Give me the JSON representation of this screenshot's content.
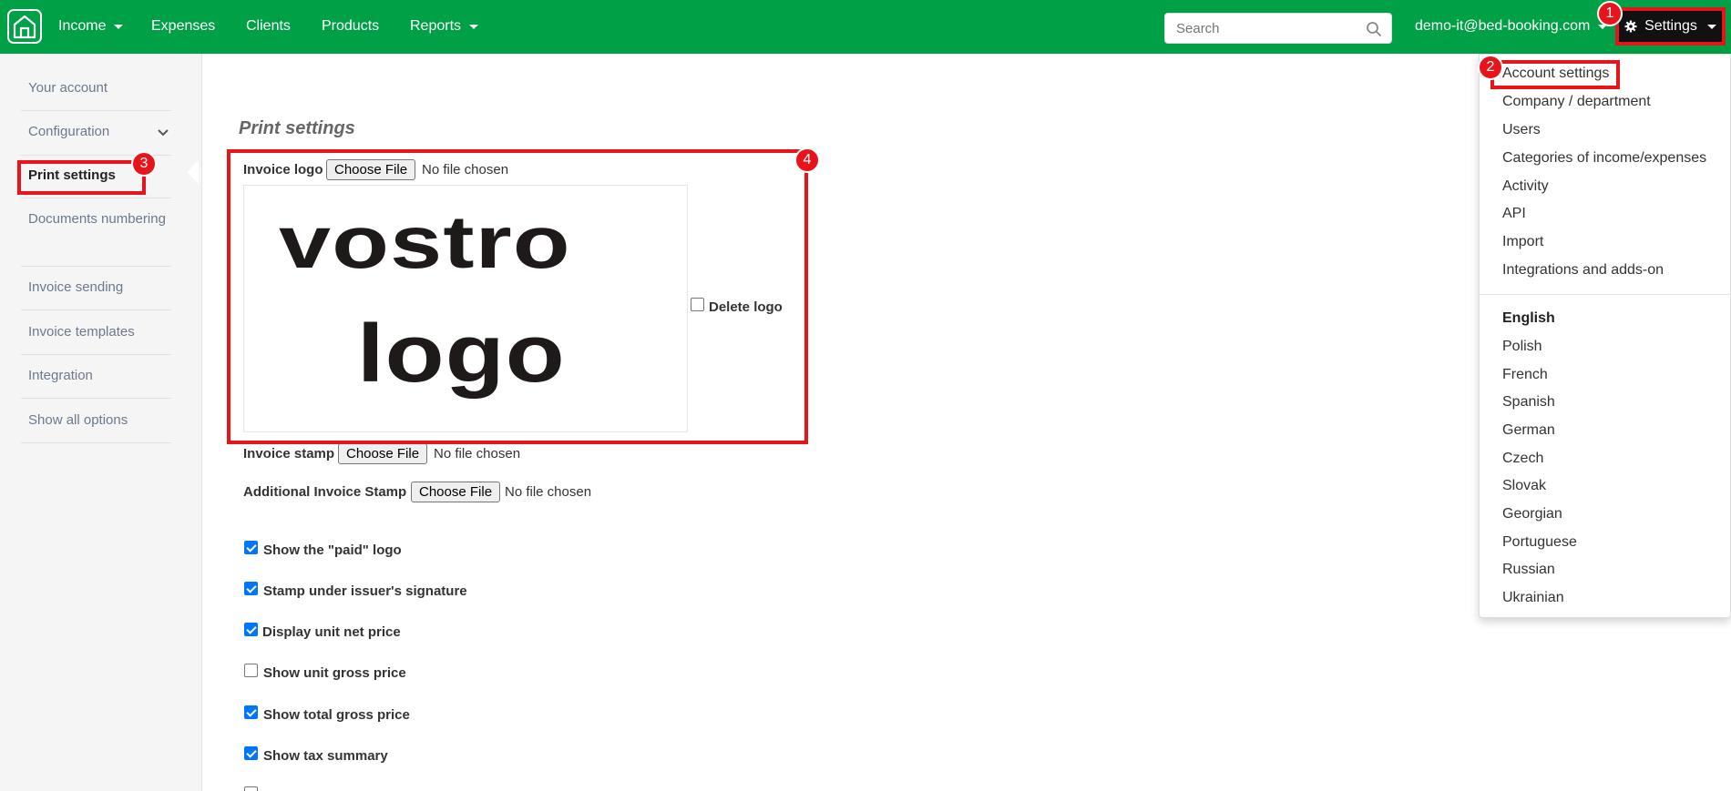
{
  "nav": {
    "items": [
      {
        "label": "Income",
        "has_caret": true
      },
      {
        "label": "Expenses",
        "has_caret": false
      },
      {
        "label": "Clients",
        "has_caret": false
      },
      {
        "label": "Products",
        "has_caret": false
      },
      {
        "label": "Reports",
        "has_caret": true
      }
    ],
    "search_placeholder": "Search",
    "user_email": "demo-it@bed-booking.com",
    "settings_label": "Settings",
    "brand_color": "#00a046"
  },
  "sidebar": {
    "items": [
      {
        "label": "Your account"
      },
      {
        "label": "Configuration"
      },
      {
        "label": "Print settings",
        "active": true
      },
      {
        "label": "Documents numbering"
      },
      {
        "label": "Invoice sending"
      },
      {
        "label": "Invoice templates"
      },
      {
        "label": "Integration"
      },
      {
        "label": "Show all options"
      }
    ]
  },
  "main": {
    "title": "Print settings",
    "invoice_logo": {
      "label": "Invoice logo",
      "button": "Choose File",
      "status": "No file chosen"
    },
    "logo_image_text": [
      "vostro",
      "logo"
    ],
    "delete_logo_label": "Delete logo",
    "invoice_stamp": {
      "label": "Invoice stamp",
      "button": "Choose File",
      "status": "No file chosen"
    },
    "additional_stamp": {
      "label": "Additional Invoice Stamp",
      "button": "Choose File",
      "status": "No file chosen"
    },
    "options": [
      {
        "label": "Show the \"paid\" logo",
        "checked": true
      },
      {
        "label": "Stamp under issuer's signature",
        "checked": true
      },
      {
        "label": "Display unit net price",
        "checked": true
      },
      {
        "label": "Show unit gross price",
        "checked": false
      },
      {
        "label": "Show total gross price",
        "checked": true
      },
      {
        "label": "Show tax summary",
        "checked": true
      }
    ]
  },
  "settings_menu": {
    "items": [
      "Account settings",
      "Company / department",
      "Users",
      "Categories of income/expenses",
      "Activity",
      "API",
      "Import",
      "Integrations and adds-on"
    ],
    "languages": [
      "English",
      "Polish",
      "French",
      "Spanish",
      "German",
      "Czech",
      "Slovak",
      "Georgian",
      "Portuguese",
      "Russian",
      "Ukrainian"
    ],
    "current_language": "English"
  },
  "annotations": {
    "badges": [
      "1",
      "2",
      "3",
      "4"
    ],
    "color": "#e8141b"
  }
}
